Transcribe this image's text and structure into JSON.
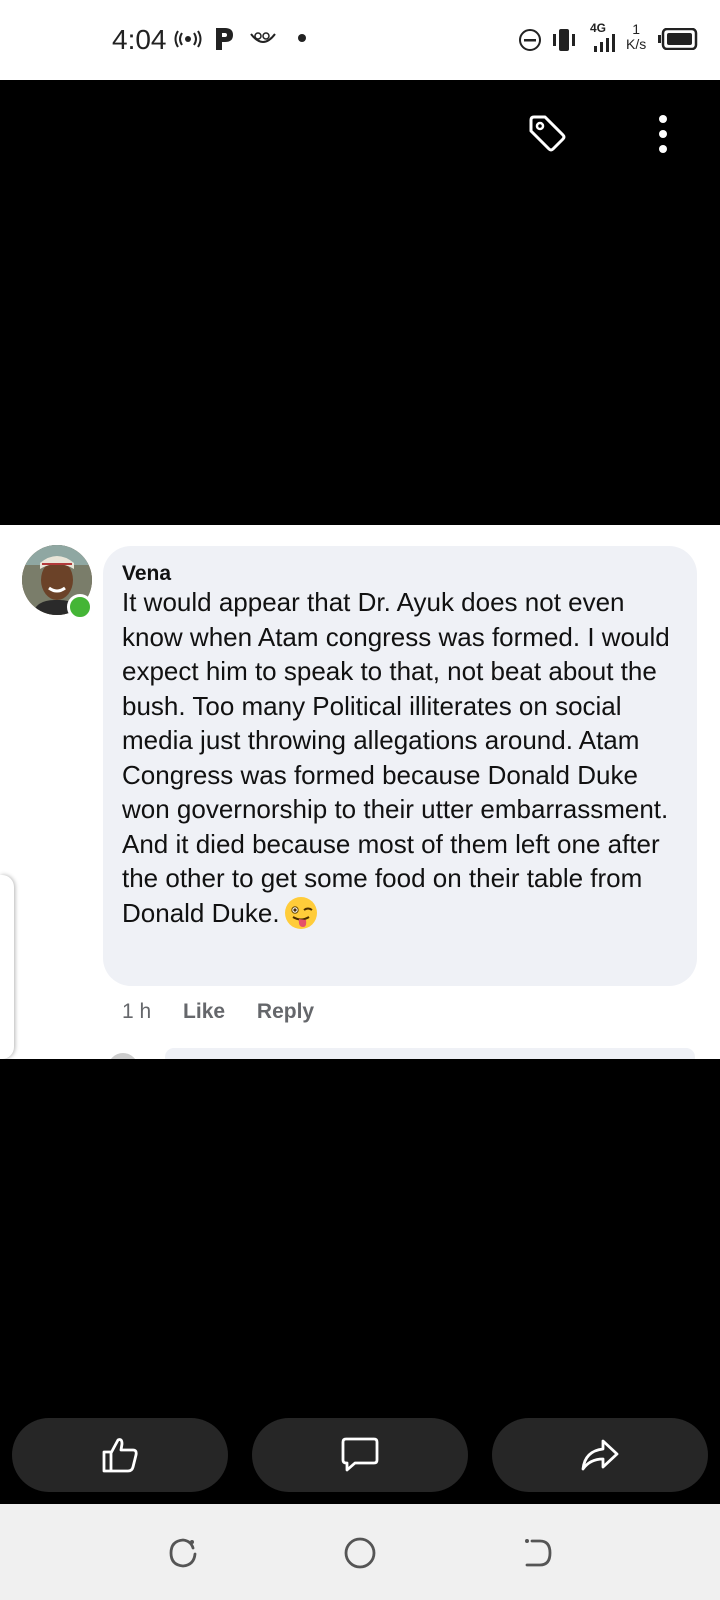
{
  "status_bar": {
    "time": "4:04",
    "network": "4G",
    "speed_value": "1",
    "speed_unit": "K/s"
  },
  "viewer": {
    "top_icons": [
      "tag-icon",
      "more-vertical-icon"
    ]
  },
  "comment": {
    "author": "Vena",
    "text": "It would appear that Dr. Ayuk does not even know when Atam congress was formed. I would expect him to speak to that, not beat about the bush. Too many Political illiterates on social media just throwing allegations around. Atam Congress was formed because Donald Duke won governorship to their utter embarrassment. And it died because most of them left one after the other to get some food on their table from Donald Duke.",
    "emoji": "winking-face-with-tongue",
    "time": "1 h",
    "like_label": "Like",
    "reply_label": "Reply",
    "online_color": "#44b536"
  },
  "actions": {
    "buttons": [
      "like-icon",
      "comment-icon",
      "share-icon"
    ]
  },
  "nav": {
    "buttons": [
      "recents-icon",
      "home-icon",
      "back-icon"
    ]
  }
}
